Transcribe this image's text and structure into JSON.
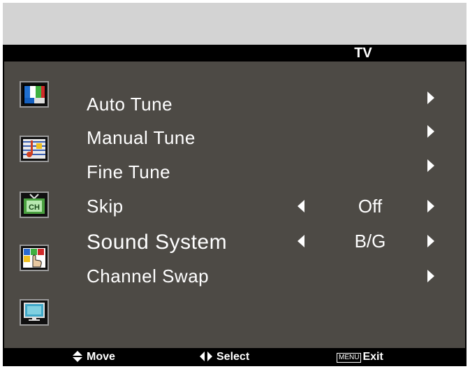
{
  "header": {
    "title": "TV"
  },
  "sidebar": {
    "icons": [
      {
        "name": "picture-icon"
      },
      {
        "name": "audio-icon"
      },
      {
        "name": "channel-icon",
        "text": "CH"
      },
      {
        "name": "feature-icon"
      },
      {
        "name": "screen-icon"
      }
    ]
  },
  "menu": {
    "items": [
      {
        "label": "Auto Tune"
      },
      {
        "label": "Manual Tune"
      },
      {
        "label": "Fine Tune"
      },
      {
        "label": "Skip",
        "value": "Off"
      },
      {
        "label": "Sound System",
        "value": "B/G"
      },
      {
        "label": "Channel Swap"
      }
    ]
  },
  "footer": {
    "move_label": "Move",
    "select_label": "Select",
    "menu_key": "MENU",
    "exit_label": "Exit"
  },
  "colors": {
    "panel": "#4d4a45",
    "top_band": "#d3d3d3",
    "bar": "#000000",
    "text": "#ffffff"
  }
}
